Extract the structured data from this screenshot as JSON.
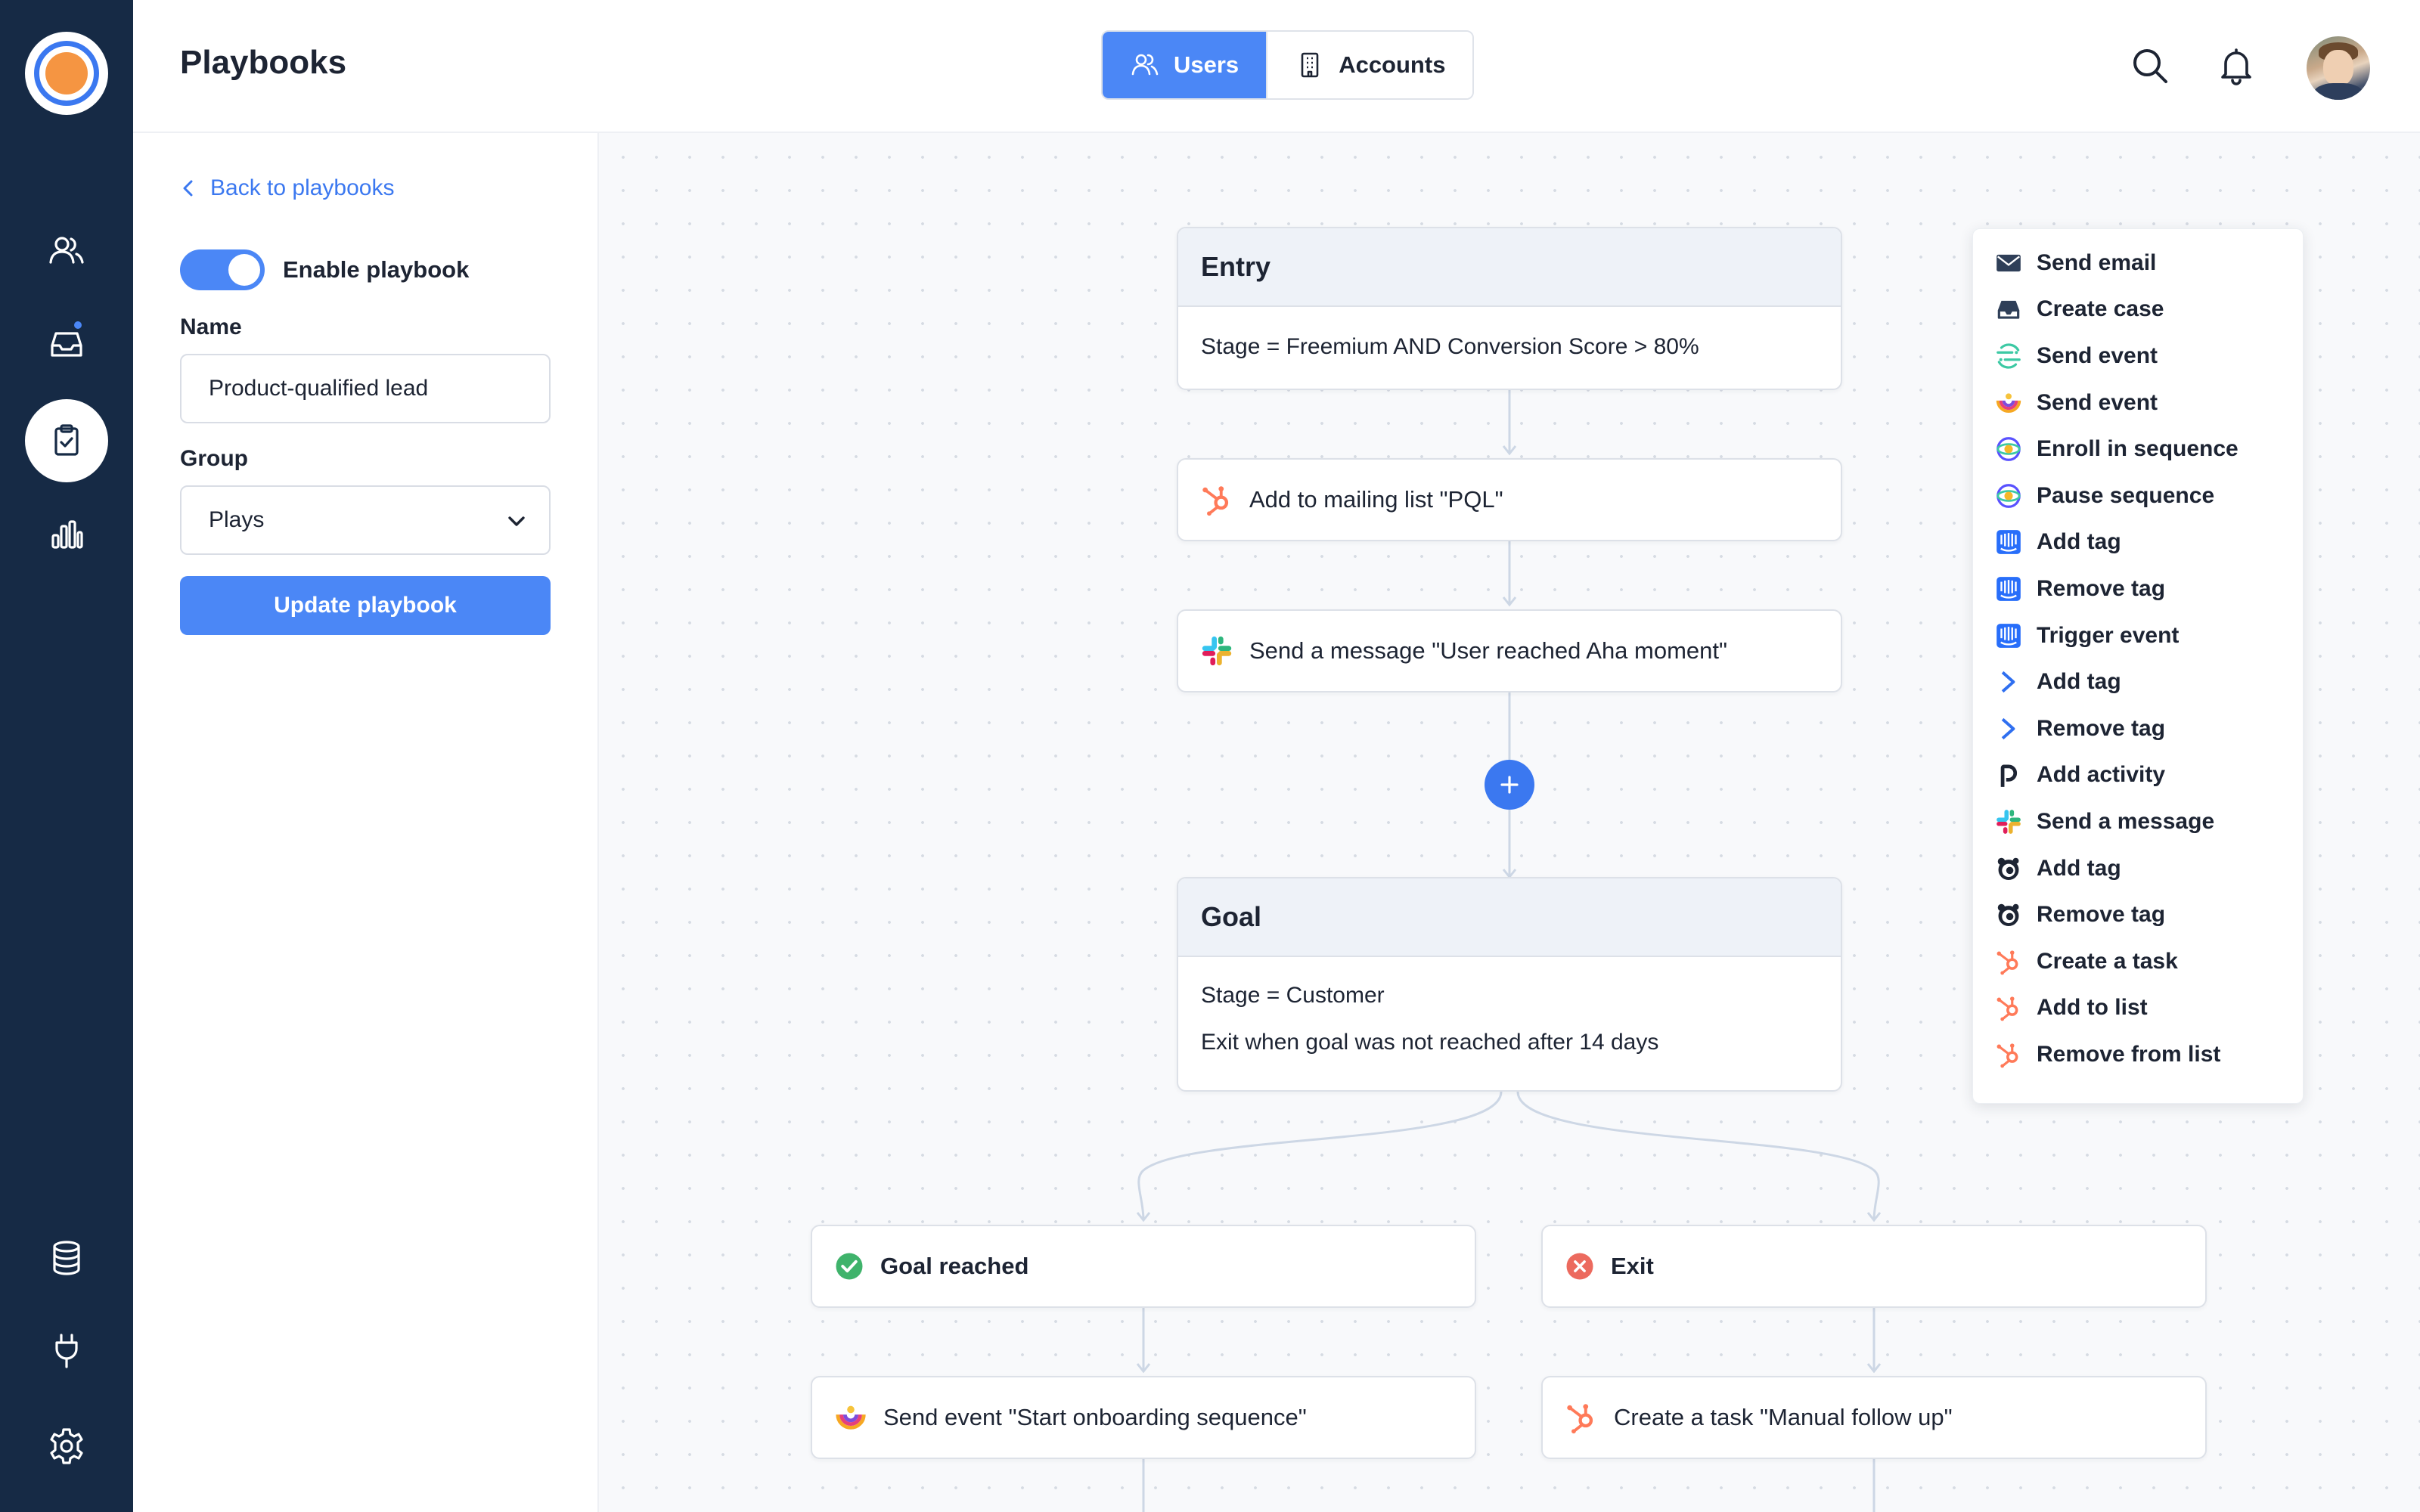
{
  "header": {
    "title": "Playbooks",
    "segments": [
      {
        "label": "Users",
        "icon": "users-icon",
        "active": true
      },
      {
        "label": "Accounts",
        "icon": "building-icon",
        "active": false
      }
    ]
  },
  "sidebar": {
    "items": [
      {
        "name": "contacts",
        "icon": "users-icon"
      },
      {
        "name": "inbox",
        "icon": "inbox-icon",
        "badge": true
      },
      {
        "name": "playbooks",
        "icon": "clipboard-check-icon",
        "active": true
      },
      {
        "name": "reports",
        "icon": "bar-chart-icon"
      },
      {
        "name": "data",
        "icon": "database-icon"
      },
      {
        "name": "integrations",
        "icon": "plug-icon"
      },
      {
        "name": "settings",
        "icon": "gear-icon"
      }
    ]
  },
  "panel": {
    "back_label": "Back to playbooks",
    "enable_label": "Enable playbook",
    "enabled": true,
    "name_label": "Name",
    "name_value": "Product-qualified lead",
    "group_label": "Group",
    "group_value": "Plays",
    "update_label": "Update playbook"
  },
  "flow": {
    "entry": {
      "title": "Entry",
      "condition": "Stage = Freemium AND Conversion Score > 80%"
    },
    "steps": [
      {
        "text": "Add to mailing list \"PQL\"",
        "icon": "hubspot-icon"
      },
      {
        "text": "Send a message \"User reached Aha moment\"",
        "icon": "slack-icon"
      }
    ],
    "goal": {
      "title": "Goal",
      "lines": [
        "Stage = Customer",
        "Exit when goal was not reached after 14 days"
      ]
    },
    "branches": [
      {
        "label": "Goal reached",
        "icon": "check-circle-icon",
        "status_color": "#3fb36b",
        "next": {
          "text": "Send event \"Start onboarding sequence\"",
          "icon": "segment-icon"
        }
      },
      {
        "label": "Exit",
        "icon": "x-circle-icon",
        "status_color": "#ec6a5e",
        "next": {
          "text": "Create a task \"Manual follow up\"",
          "icon": "hubspot-icon"
        }
      }
    ]
  },
  "action_menu": {
    "items": [
      {
        "label": "Send email",
        "icon": "envelope-icon"
      },
      {
        "label": "Create case",
        "icon": "inbox-tray-icon"
      },
      {
        "label": "Send event",
        "icon": "segment-icon"
      },
      {
        "label": "Send event",
        "icon": "rainbow-icon"
      },
      {
        "label": "Enroll in sequence",
        "icon": "outreach-icon"
      },
      {
        "label": "Pause sequence",
        "icon": "outreach-icon"
      },
      {
        "label": "Add tag",
        "icon": "intercom-icon"
      },
      {
        "label": "Remove tag",
        "icon": "intercom-icon"
      },
      {
        "label": "Trigger event",
        "icon": "intercom-icon"
      },
      {
        "label": "Add tag",
        "icon": "chevron-logo-icon"
      },
      {
        "label": "Remove tag",
        "icon": "chevron-logo-icon"
      },
      {
        "label": "Add activity",
        "icon": "pipedrive-icon"
      },
      {
        "label": "Send a message",
        "icon": "slack-icon"
      },
      {
        "label": "Add tag",
        "icon": "mailchimp-icon"
      },
      {
        "label": "Remove tag",
        "icon": "mailchimp-icon"
      },
      {
        "label": "Create a task",
        "icon": "hubspot-icon"
      },
      {
        "label": "Add to list",
        "icon": "hubspot-icon"
      },
      {
        "label": "Remove from list",
        "icon": "hubspot-icon"
      }
    ]
  },
  "colors": {
    "rail": "#162a45",
    "accent": "#4b87f6",
    "canvas": "#f8f9fb",
    "hubspot": "#ff7a59",
    "intercom": "#286efa",
    "outreach": "#5951ff"
  }
}
